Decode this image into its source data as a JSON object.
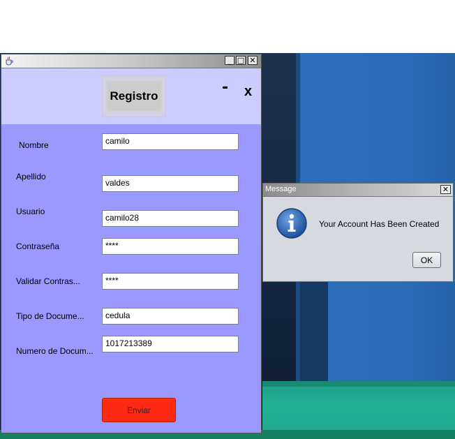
{
  "main_window": {
    "titlebar": {
      "icon": "java-cup-icon",
      "buttons": {
        "minimize": "_",
        "maximize": "□",
        "close": "✕"
      }
    },
    "header": {
      "title": "Registro",
      "min_label": "-",
      "close_label": "x"
    },
    "form": {
      "fields": [
        {
          "label": "Nombre",
          "value": "camilo"
        },
        {
          "label": "Apellido",
          "value": "valdes"
        },
        {
          "label": "Usuario",
          "value": "camilo28"
        },
        {
          "label": "Contraseña",
          "value": "****"
        },
        {
          "label": "Validar Contras...",
          "value": "****"
        },
        {
          "label": "Tipo de Docume...",
          "value": "cedula"
        },
        {
          "label": "Numero de Docum...",
          "value": "1017213389"
        }
      ],
      "submit_label": "Enviar"
    }
  },
  "dialog": {
    "title": "Message",
    "close_label": "✕",
    "icon": "info-icon",
    "message": "Your Account Has Been Created",
    "ok_label": "OK"
  },
  "colors": {
    "form_bg": "#9999ff",
    "header_bg": "#ccccff",
    "submit_bg": "#ff2a14"
  }
}
